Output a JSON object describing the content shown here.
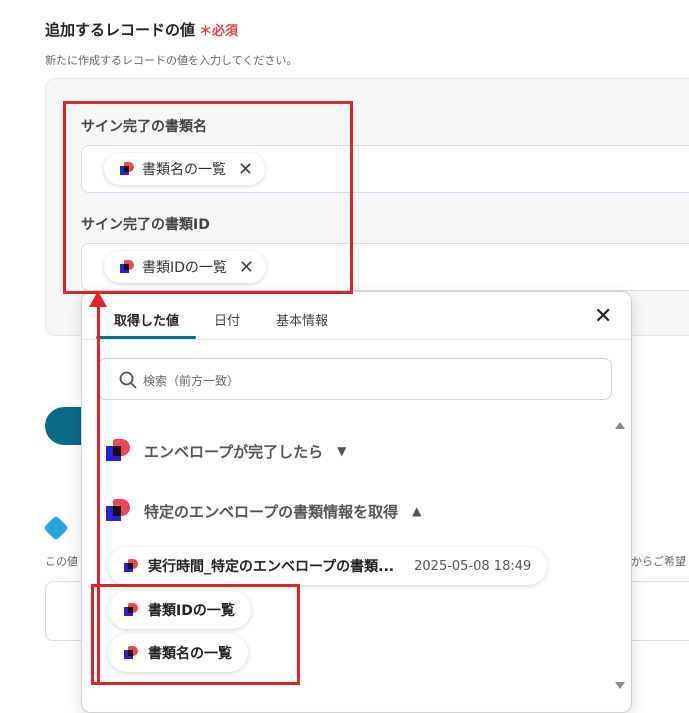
{
  "section": {
    "title": "追加するレコードの値",
    "required_mark": "＊必須",
    "description": "新たに作成するレコードの値を入力してください。"
  },
  "fields": [
    {
      "label": "サイン完了の書類名",
      "chip": "書類名の一覧"
    },
    {
      "label": "サイン完了の書類ID",
      "chip": "書類IDの一覧"
    }
  ],
  "background": {
    "text_left": "この値",
    "text_right": "からご希望"
  },
  "dropdown": {
    "tabs": [
      "取得した値",
      "日付",
      "基本情報"
    ],
    "active_tab": "取得した値",
    "search_placeholder": "検索（前方一致）",
    "groups": [
      {
        "label": "エンベロープが完了したら",
        "expanded": false
      },
      {
        "label": "特定のエンベロープの書類情報を取得",
        "expanded": true
      }
    ],
    "items": [
      {
        "label": "実行時間_特定のエンベロープの書類...",
        "value": "2025-05-08 18:49"
      },
      {
        "label": "書類IDの一覧",
        "value": ""
      },
      {
        "label": "書類名の一覧",
        "value": ""
      }
    ]
  },
  "colors": {
    "accent": "#0b6a86",
    "highlight": "#d9262b",
    "required": "#e0454f"
  }
}
